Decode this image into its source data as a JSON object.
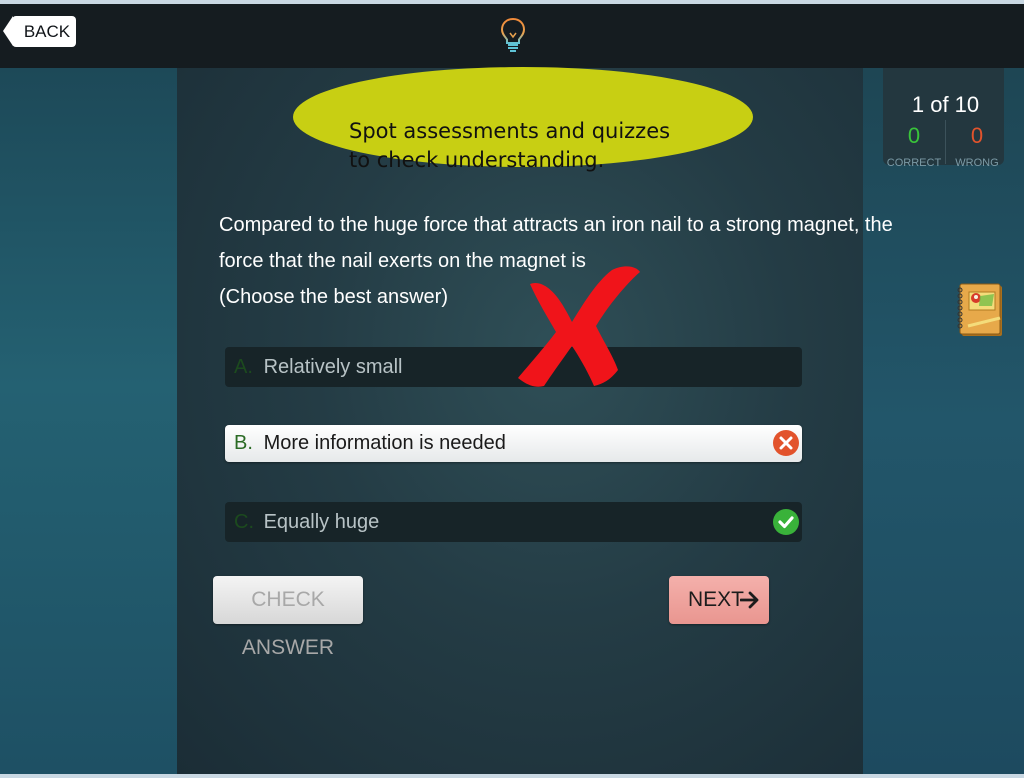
{
  "header": {
    "back_label": "BACK"
  },
  "callout": {
    "text": "Spot assessments and quizzes\nto check understanding."
  },
  "score": {
    "progress": "1 of 10",
    "correct_count": "0",
    "wrong_count": "0",
    "correct_label": "CORRECT",
    "wrong_label": "WRONG"
  },
  "question": {
    "lines": [
      "Compared to the huge force that attracts an iron nail to a strong magnet, the",
      "force that the nail exerts on the magnet is",
      "(Choose the best answer)"
    ]
  },
  "answers": [
    {
      "letter": "A.",
      "text": "Relatively small",
      "state": "unselected"
    },
    {
      "letter": "B.",
      "text": "More information is needed",
      "state": "selected-wrong"
    },
    {
      "letter": "C.",
      "text": "Equally huge",
      "state": "correct"
    }
  ],
  "buttons": {
    "check_answer": "CHECK ANSWER",
    "next": "NEXT"
  },
  "colors": {
    "callout_bg": "#c8cf13",
    "correct": "#39c43a",
    "wrong": "#e2532c",
    "next_button": "#f4b0ab"
  },
  "icons": [
    "lightbulb-icon",
    "notebook-icon",
    "wrong-x-icon",
    "correct-check-icon",
    "big-red-x-icon",
    "arrow-right-icon"
  ]
}
